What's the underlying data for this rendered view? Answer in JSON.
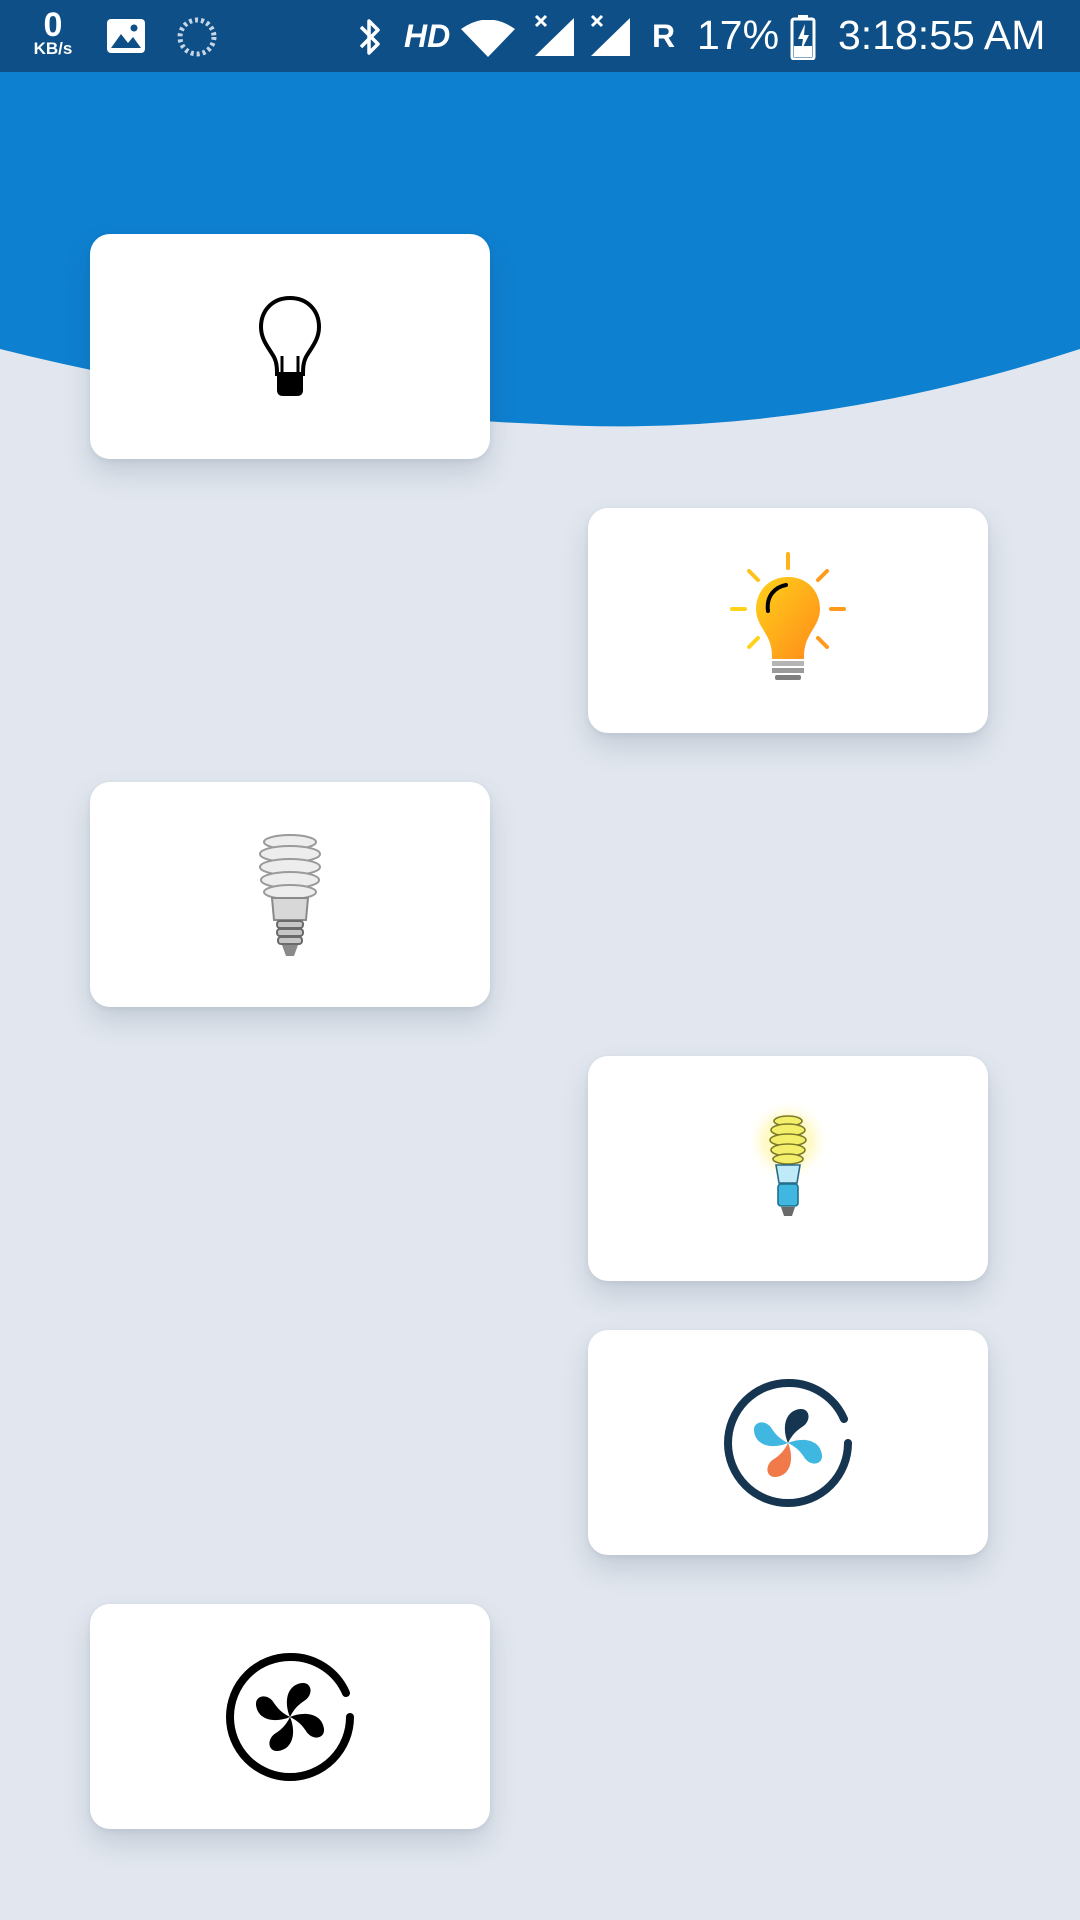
{
  "status_bar": {
    "net_speed_value": "0",
    "net_speed_unit": "KB/s",
    "network_type": "HD",
    "roaming": "R",
    "battery": "17%",
    "time": "3:18:55 AM"
  },
  "colors": {
    "header_blue": "#0e80d0",
    "status_bar": "#0d4f86",
    "background": "#e2e7ef",
    "card": "#ffffff"
  },
  "devices": [
    {
      "name": "bulb-off",
      "icon": "lightbulb-outline-icon"
    },
    {
      "name": "bulb-on",
      "icon": "lightbulb-glowing-icon"
    },
    {
      "name": "cfl-off",
      "icon": "cfl-bulb-off-icon"
    },
    {
      "name": "cfl-on",
      "icon": "cfl-bulb-on-icon"
    },
    {
      "name": "fan-on",
      "icon": "fan-colored-icon"
    },
    {
      "name": "fan-off",
      "icon": "fan-outline-icon"
    }
  ]
}
